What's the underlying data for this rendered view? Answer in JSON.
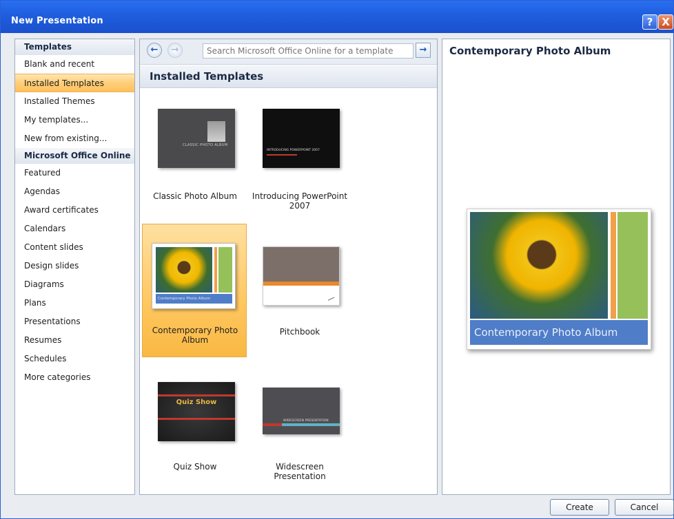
{
  "window": {
    "title": "New Presentation",
    "help_label": "?",
    "close_label": "X"
  },
  "sidebar": {
    "sections": [
      {
        "header": "Templates",
        "items": [
          "Blank and recent",
          "Installed Templates",
          "Installed Themes",
          "My templates...",
          "New from existing..."
        ]
      },
      {
        "header": "Microsoft Office Online",
        "items": [
          "Featured",
          "Agendas",
          "Award certificates",
          "Calendars",
          "Content slides",
          "Design slides",
          "Diagrams",
          "Plans",
          "Presentations",
          "Resumes",
          "Schedules",
          "More categories"
        ]
      }
    ],
    "selected": "Installed Templates"
  },
  "nav": {
    "back_icon": "arrow-left-icon",
    "forward_icon": "arrow-right-icon",
    "search_placeholder": "Search Microsoft Office Online for a template",
    "go_icon": "arrow-right-icon"
  },
  "main": {
    "heading": "Installed Templates",
    "templates": [
      {
        "label": "Classic Photo Album",
        "thumb_text": "CLASSIC PHOTO ALBUM"
      },
      {
        "label": "Introducing PowerPoint 2007",
        "thumb_text": "INTRODUCING POWERPOINT 2007"
      },
      {
        "label": "Contemporary Photo Album",
        "thumb_text": "Contemporary Photo Album"
      },
      {
        "label": "Pitchbook",
        "thumb_text": ""
      },
      {
        "label": "Quiz Show",
        "thumb_text": "Quiz Show"
      },
      {
        "label": "Widescreen Presentation",
        "thumb_text": "WIDESCREEN PRESENTATION"
      }
    ],
    "selected": "Contemporary Photo Album"
  },
  "preview": {
    "title": "Contemporary Photo Album",
    "caption": "Contemporary Photo Album"
  },
  "buttons": {
    "create": "Create",
    "cancel": "Cancel"
  },
  "colors": {
    "selection": "#ffc760",
    "title_bar": "#1f5fe0",
    "accent_green": "#95c05a",
    "accent_orange": "#f0a04a",
    "caption_blue": "#4f7dc8"
  }
}
